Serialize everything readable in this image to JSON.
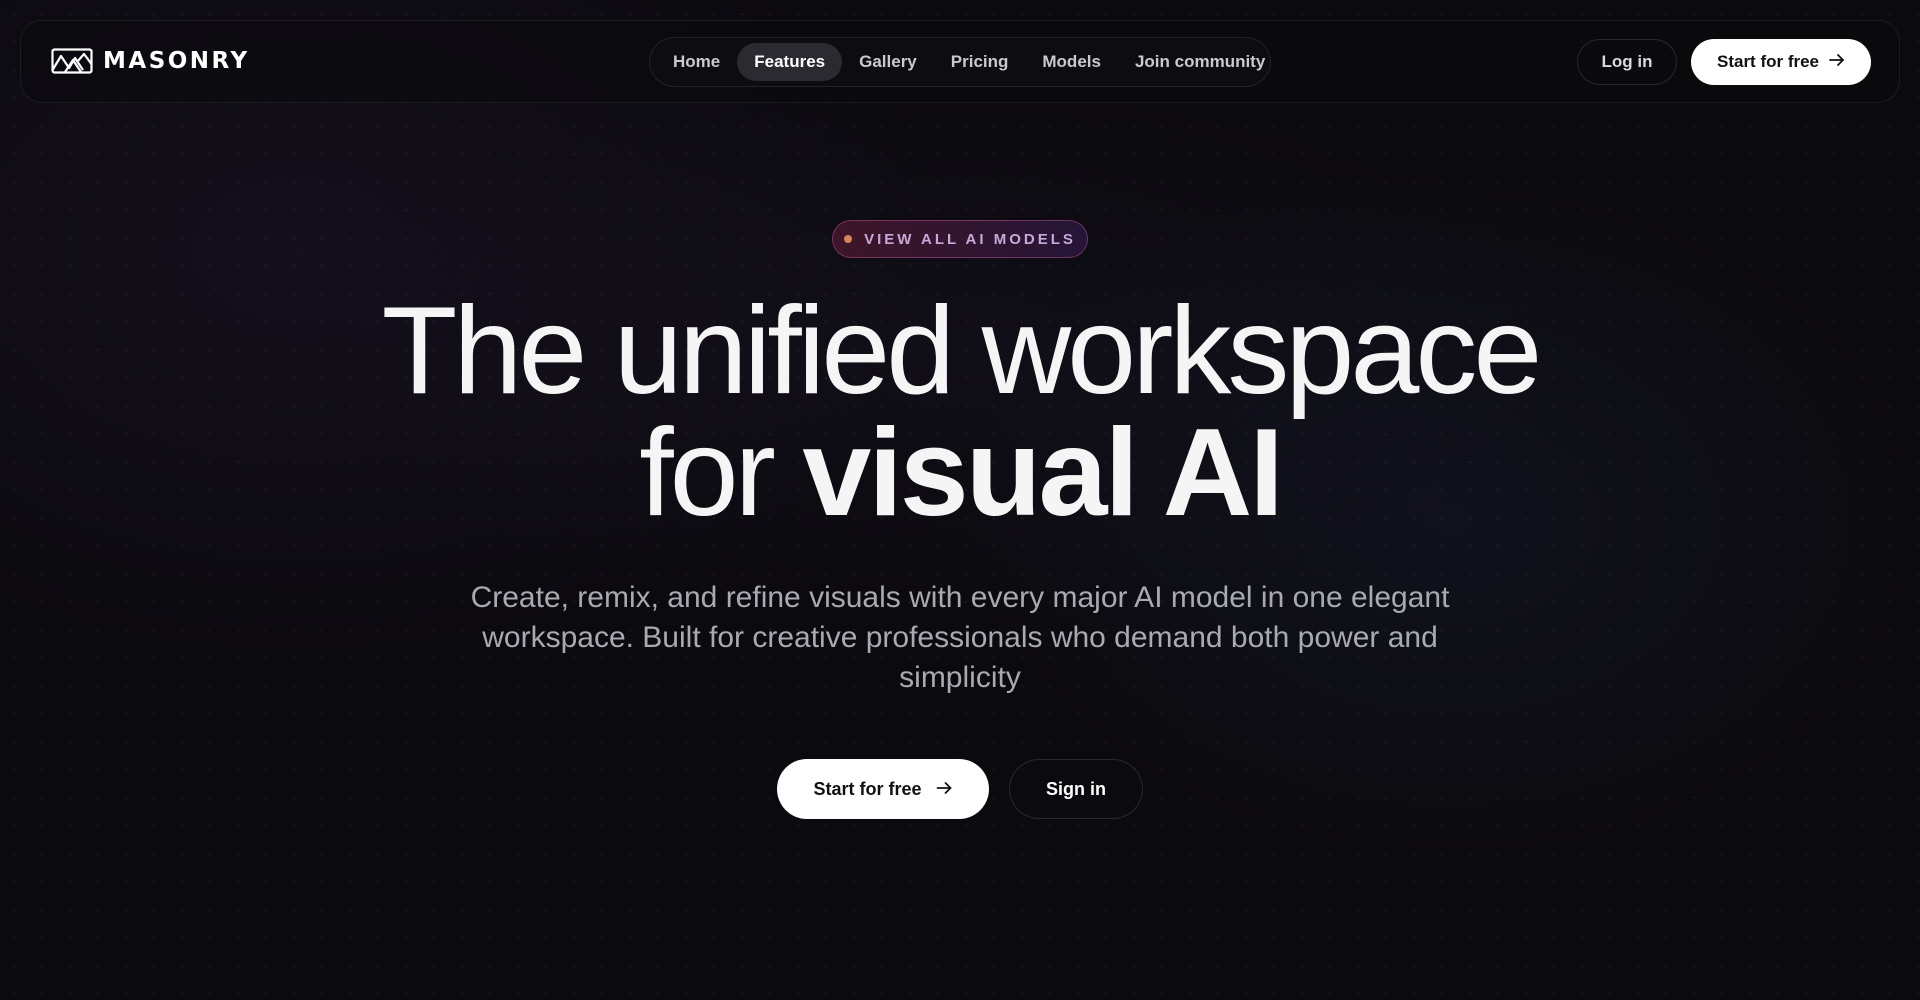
{
  "brand": {
    "name": "MASONRY",
    "logo_icon": "masonry-logo-icon"
  },
  "nav": {
    "items": [
      {
        "label": "Home",
        "active": false
      },
      {
        "label": "Features",
        "active": true
      },
      {
        "label": "Gallery",
        "active": false
      },
      {
        "label": "Pricing",
        "active": false
      },
      {
        "label": "Models",
        "active": false
      },
      {
        "label": "Join community",
        "active": false
      }
    ]
  },
  "header_actions": {
    "login_label": "Log in",
    "start_label": "Start for free",
    "start_icon": "arrow-right-icon"
  },
  "hero": {
    "badge": "VIEW ALL AI MODELS",
    "headline_line1": "The unified workspace",
    "headline_line2_prefix": "for ",
    "headline_line2_strong": "visual AI",
    "subtitle": "Create, remix, and refine visuals with every major AI model in one elegant workspace. Built for creative professionals who demand both power and simplicity",
    "primary_cta": "Start for free",
    "secondary_cta": "Sign in"
  },
  "colors": {
    "background": "#0b0a0e",
    "button_primary_bg": "#ffffff",
    "active_nav_bg": "#2a2a30",
    "badge_dot": "#d58558",
    "badge_text": "#c8a8d8"
  }
}
